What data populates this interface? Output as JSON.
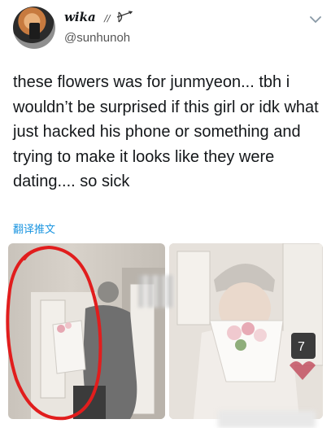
{
  "author": {
    "display_name": "wika",
    "name_suffix": "//",
    "handle": "@sunhunoh"
  },
  "tweet": {
    "text": "these flowers was for junmyeon... tbh i wouldn’t be surprised if this girl or idk what just hacked his phone or something and trying to make it looks like they were dating.... so sick",
    "translate_label": "翻译推文"
  },
  "media": {
    "images": [
      {
        "description_icon": "photo-left",
        "overlay_text": ""
      },
      {
        "description_icon": "photo-right",
        "overlay_text": "7"
      }
    ]
  },
  "colors": {
    "link": "#1b95e0",
    "annotation": "#e11d1d",
    "text": "#14171a"
  }
}
